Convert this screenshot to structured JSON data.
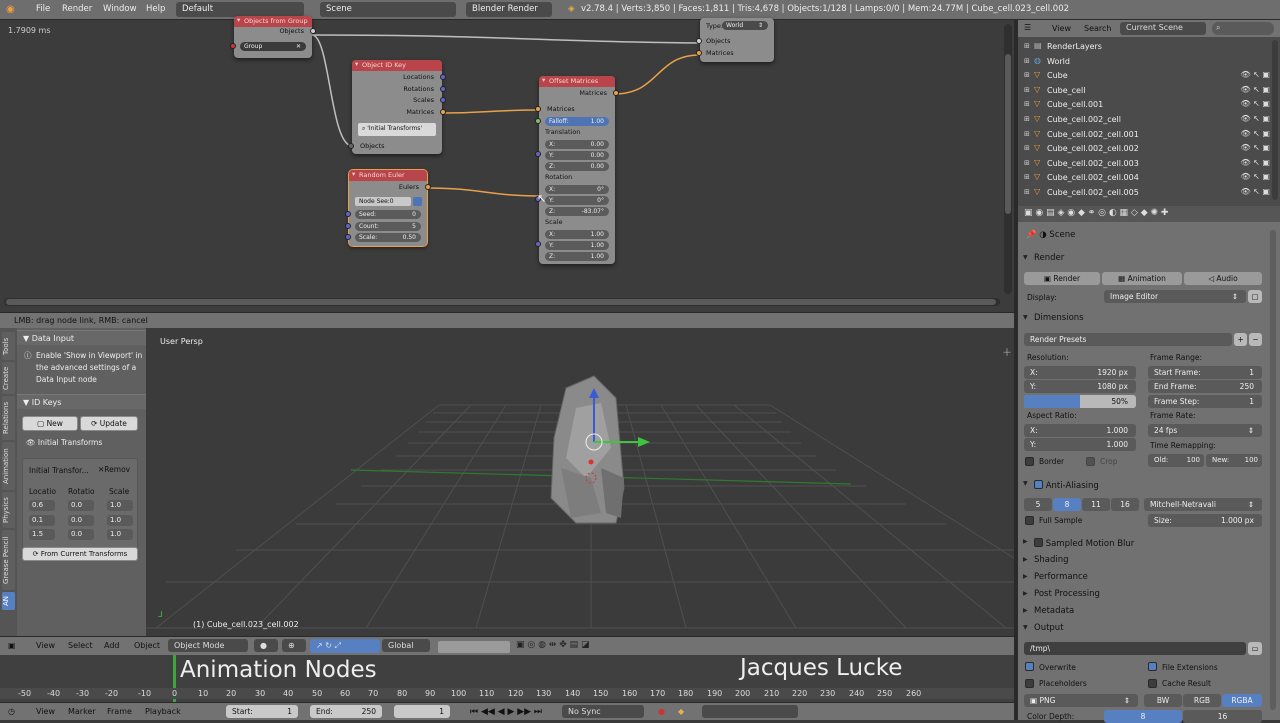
{
  "topbar": {
    "menus": [
      "File",
      "Render",
      "Window",
      "Help"
    ],
    "layout": "Default",
    "scene": "Scene",
    "engine": "Blender Render",
    "stats": "v2.78.4 | Verts:3,850 | Faces:1,811 | Tris:4,678 | Objects:1/128 | Lamps:0/0 | Mem:24.77M | Cube_cell.023_cell.002"
  },
  "node_editor": {
    "timing": "1.7909 ms",
    "nodes": {
      "objects_from_group": {
        "title": "Objects from Group",
        "out": "Objects",
        "group_field": "Group"
      },
      "object_id_key": {
        "title": "Object ID Key",
        "outputs": [
          "Locations",
          "Rotations",
          "Scales",
          "Matrices"
        ],
        "key_field": "'Initial Transforms'",
        "input": "Objects"
      },
      "offset_matrices": {
        "title": "Offset Matrices",
        "out": "Matrices",
        "in": "Matrices",
        "falloff_label": "Falloff:",
        "falloff_value": "1.00",
        "translation": "Translation",
        "tx": "0.00",
        "ty": "0.00",
        "tz": "0.00",
        "rotation": "Rotation",
        "rx": "0°",
        "ry": "0°",
        "rz": "-83.07°",
        "scale": "Scale",
        "sx": "1.00",
        "sy": "1.00",
        "sz": "1.00",
        "x": "X:",
        "y": "Y:",
        "z": "Z:"
      },
      "random_euler": {
        "title": "Random Euler",
        "out": "Eulers",
        "node_seed": "Node See:0",
        "seed_label": "Seed:",
        "seed": "0",
        "count_label": "Count:",
        "count": "5",
        "scale_label": "Scale:",
        "scale": "0.50"
      },
      "transform_target": {
        "type_label": "Type:",
        "type_value": "World",
        "objects": "Objects",
        "matrices": "Matrices"
      }
    }
  },
  "status": "LMB: drag node link, RMB: cancel",
  "toolshelf": {
    "tabs": [
      "Tools",
      "Create",
      "Relations",
      "Animation",
      "Physics",
      "Grease Pencil",
      "AN"
    ],
    "data_input_title": "Data Input",
    "data_input_text": [
      "Enable 'Show in Viewport' in",
      "the advanced settings of a",
      "Data Input node"
    ],
    "id_keys_title": "ID Keys",
    "new_label": "New",
    "update_label": "Update",
    "key_name": "Initial Transforms",
    "key_row": "Initial Transfor...",
    "remove_label": "Remov",
    "col_headers": [
      "Locatio",
      "Rotatio",
      "Scale"
    ],
    "values": [
      [
        "0.6",
        "0.0",
        "1.0"
      ],
      [
        "0.1",
        "0.0",
        "1.0"
      ],
      [
        "1.5",
        "0.0",
        "1.0"
      ]
    ],
    "from_current": "From Current Transforms"
  },
  "viewport": {
    "mode_label": "User Persp",
    "object_label": "(1) Cube_cell.023_cell.002",
    "header": {
      "view": "View",
      "select": "Select",
      "add": "Add",
      "object": "Object",
      "mode": "Object Mode",
      "orientation": "Global"
    }
  },
  "timeline": {
    "ticks": [
      "-50",
      "-40",
      "-30",
      "-20",
      "-10",
      "0",
      "10",
      "20",
      "30",
      "40",
      "50",
      "60",
      "70",
      "80",
      "90",
      "100",
      "110",
      "120",
      "130",
      "140",
      "150",
      "160",
      "170",
      "180",
      "190",
      "200",
      "210",
      "220",
      "230",
      "240",
      "250",
      "260"
    ],
    "overlay_left": "Animation Nodes",
    "overlay_right": "Jacques Lucke",
    "menus": [
      "View",
      "Marker",
      "Frame",
      "Playback"
    ],
    "start_label": "Start:",
    "start": "1",
    "end_label": "End:",
    "end": "250",
    "current": "1",
    "sync": "No Sync"
  },
  "outliner": {
    "menus": [
      "View",
      "Search"
    ],
    "scene_select": "Current Scene",
    "items": [
      "RenderLayers",
      "World",
      "Cube",
      "Cube_cell",
      "Cube_cell.001",
      "Cube_cell.002_cell",
      "Cube_cell.002_cell.001",
      "Cube_cell.002_cell.002",
      "Cube_cell.002_cell.003",
      "Cube_cell.002_cell.004",
      "Cube_cell.002_cell.005"
    ]
  },
  "properties": {
    "breadcrumb": "Scene",
    "render_title": "Render",
    "render_btn": "Render",
    "animation_btn": "Animation",
    "audio_btn": "Audio",
    "display_label": "Display:",
    "display_value": "Image Editor",
    "dimensions_title": "Dimensions",
    "render_presets": "Render Presets",
    "resolution_label": "Resolution:",
    "res_x_label": "X:",
    "res_x": "1920 px",
    "res_y_label": "Y:",
    "res_y": "1080 px",
    "res_pct": "50%",
    "res_pct_fraction": 0.5,
    "frame_range_label": "Frame Range:",
    "start_frame_label": "Start Frame:",
    "start_frame": "1",
    "end_frame_label": "End Frame:",
    "end_frame": "250",
    "frame_step_label": "Frame Step:",
    "frame_step": "1",
    "aspect_label": "Aspect Ratio:",
    "asp_x": "1.000",
    "asp_y": "1.000",
    "frame_rate_label": "Frame Rate:",
    "frame_rate": "24 fps",
    "time_remap_label": "Time Remapping:",
    "old_label": "Old:",
    "old": "100",
    "new_label": "New:",
    "new": "100",
    "border_label": "Border",
    "crop_label": "Crop",
    "aa_title": "Anti-Aliasing",
    "aa_samples": [
      "5",
      "8",
      "11",
      "16"
    ],
    "aa_filter": "Mitchell-Netravali",
    "full_sample": "Full Sample",
    "size_label": "Size:",
    "size": "1.000 px",
    "motion_blur": "Sampled Motion Blur",
    "shading": "Shading",
    "performance": "Performance",
    "post_processing": "Post Processing",
    "metadata": "Metadata",
    "output_title": "Output",
    "output_path": "/tmp\\",
    "overwrite": "Overwrite",
    "file_ext": "File Extensions",
    "placeholders": "Placeholders",
    "cache_result": "Cache Result",
    "format": "PNG",
    "bw": "BW",
    "rgb": "RGB",
    "rgba": "RGBA",
    "color_depth_label": "Color Depth:",
    "depth_8": "8",
    "depth_16": "16"
  },
  "colors": {
    "accent": "#5680c2",
    "node_header": "#b9454a",
    "link": "#e8a14a"
  }
}
